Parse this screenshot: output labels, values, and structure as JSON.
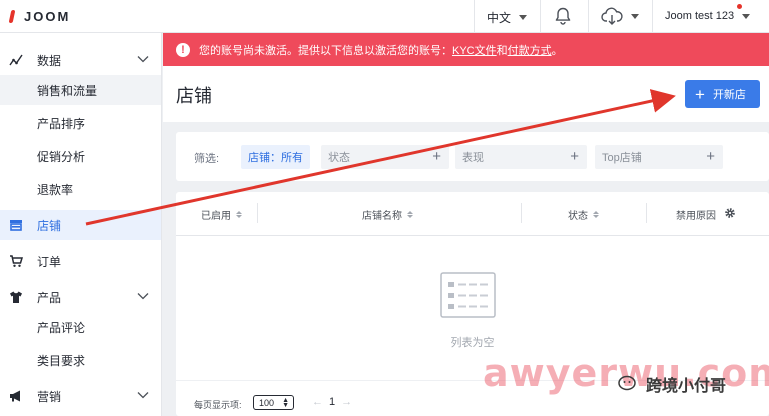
{
  "topbar": {
    "logo_text": "JOOM",
    "language": "中文",
    "user": "Joom test 123"
  },
  "sidebar": {
    "items": [
      {
        "label": "数据",
        "icon": "chart-line-icon",
        "expandable": true
      },
      {
        "label": "销售和流量"
      },
      {
        "label": "产品排序"
      },
      {
        "label": "促销分析"
      },
      {
        "label": "退款率"
      },
      {
        "label": "店铺",
        "icon": "store-icon",
        "active": true
      },
      {
        "label": "订单",
        "icon": "cart-icon"
      },
      {
        "label": "产品",
        "icon": "tshirt-icon",
        "expandable": true
      },
      {
        "label": "产品评论"
      },
      {
        "label": "类目要求"
      },
      {
        "label": "营销",
        "icon": "megaphone-icon",
        "expandable": true
      }
    ]
  },
  "alert": {
    "text": "您的账号尚未激活。提供以下信息以激活您的账号：",
    "link1": "KYC文件",
    "middle": "和",
    "link2": "付款方式",
    "end": "。"
  },
  "header": {
    "title": "店铺",
    "open_button": "开新店"
  },
  "filter": {
    "label": "筛选:",
    "chips": [
      {
        "label": "店铺：所有",
        "active": true
      },
      {
        "label": "状态"
      },
      {
        "label": "表现"
      },
      {
        "label": "Top店铺"
      }
    ]
  },
  "table": {
    "columns": [
      "已启用",
      "店铺名称",
      "状态",
      "禁用原因"
    ],
    "empty_text": "列表为空",
    "per_page_label": "每页显示项:",
    "per_page_value": "100",
    "page": "1"
  },
  "watermark": {
    "latin": "awyerwu.com",
    "cn": "跨境小付哥"
  },
  "colors": {
    "accent": "#3a7be8",
    "alert": "#ef4a5b",
    "arrow": "#e0362c"
  }
}
